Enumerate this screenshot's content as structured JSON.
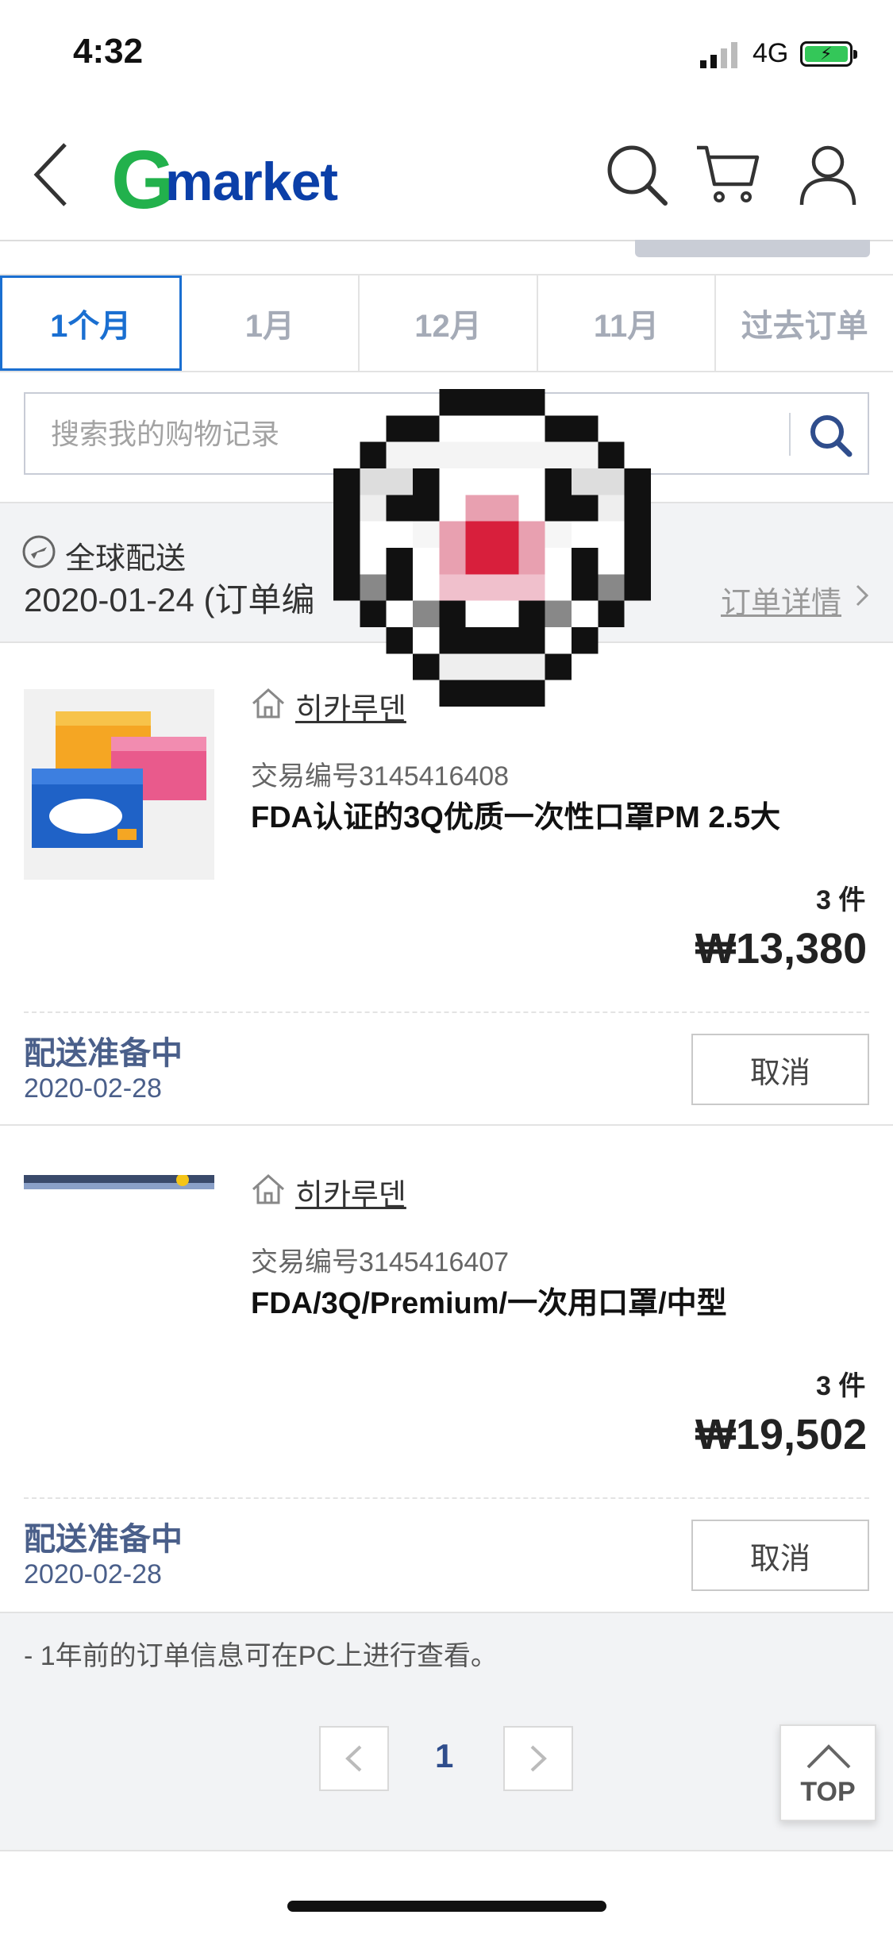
{
  "status_bar": {
    "time": "4:32",
    "network": "4G"
  },
  "header": {
    "logo_g": "G",
    "logo_text": "market"
  },
  "tabs": [
    {
      "label": "1个月",
      "active": true
    },
    {
      "label": "1月",
      "active": false
    },
    {
      "label": "12月",
      "active": false
    },
    {
      "label": "11月",
      "active": false
    },
    {
      "label": "过去订单",
      "active": false
    }
  ],
  "search": {
    "placeholder": "搜索我的购物记录"
  },
  "order": {
    "shipping_type": "全球配送",
    "date_line": "2020-01-24 (订单编",
    "detail_link": "订单详情"
  },
  "items": [
    {
      "seller": "히카루덴",
      "trade_no": "交易编号3145416408",
      "title": "FDA认证的3Q优质一次性口罩PM 2.5大",
      "qty": "3 件",
      "price": "₩13,380",
      "status": "配送准备中",
      "status_date": "2020-02-28",
      "cancel_label": "取消"
    },
    {
      "seller": "히카루덴",
      "trade_no": "交易编号3145416407",
      "title": "FDA/3Q/Premium/一次用口罩/中型",
      "qty": "3 件",
      "price": "₩19,502",
      "status": "配送准备中",
      "status_date": "2020-02-28",
      "cancel_label": "取消"
    }
  ],
  "footer": {
    "notice": "- 1年前的订单信息可在PC上进行查看。",
    "page": "1",
    "top_label": "TOP"
  },
  "colors": {
    "accent_blue": "#1a6fd1",
    "brand_green": "#22b14c",
    "brand_navy": "#0b3fa8",
    "status_navy": "#4a5f8a"
  }
}
